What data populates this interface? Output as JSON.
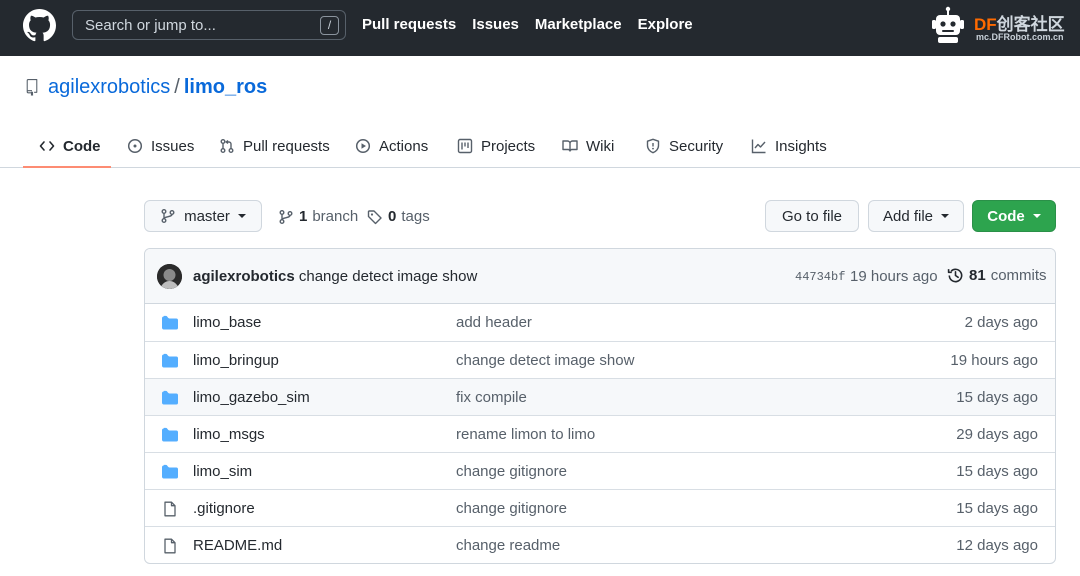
{
  "header": {
    "search_placeholder": "Search or jump to...",
    "search_shortcut": "/",
    "nav": [
      "Pull requests",
      "Issues",
      "Marketplace",
      "Explore"
    ]
  },
  "watermark": {
    "brand_df": "DF",
    "brand_cn": "创客社区",
    "url": "mc.DFRobot.com.cn"
  },
  "repo": {
    "owner": "agilexrobotics",
    "separator": "/",
    "name": "limo_ros"
  },
  "tabs": [
    {
      "label": "Code",
      "icon": "code-icon",
      "active": true
    },
    {
      "label": "Issues",
      "icon": "issue-opened-icon"
    },
    {
      "label": "Pull requests",
      "icon": "git-pull-request-icon"
    },
    {
      "label": "Actions",
      "icon": "play-icon"
    },
    {
      "label": "Projects",
      "icon": "project-icon"
    },
    {
      "label": "Wiki",
      "icon": "book-icon"
    },
    {
      "label": "Security",
      "icon": "shield-icon"
    },
    {
      "label": "Insights",
      "icon": "graph-icon"
    }
  ],
  "branch": {
    "current": "master",
    "branch_count": "1",
    "branch_label": "branch",
    "tag_count": "0",
    "tag_label": "tags"
  },
  "actions": {
    "go_to_file": "Go to file",
    "add_file": "Add file",
    "code": "Code"
  },
  "last_commit": {
    "author": "agilexrobotics",
    "message": "change detect image show",
    "sha": "44734bf",
    "time": "19 hours ago",
    "commit_count": "81",
    "commit_label": "commits"
  },
  "files": [
    {
      "name": "limo_base",
      "type": "dir",
      "message": "add header",
      "age": "2 days ago"
    },
    {
      "name": "limo_bringup",
      "type": "dir",
      "message": "change detect image show",
      "age": "19 hours ago"
    },
    {
      "name": "limo_gazebo_sim",
      "type": "dir",
      "message": "fix compile",
      "age": "15 days ago"
    },
    {
      "name": "limo_msgs",
      "type": "dir",
      "message": "rename limon to limo",
      "age": "29 days ago"
    },
    {
      "name": "limo_sim",
      "type": "dir",
      "message": "change gitignore",
      "age": "15 days ago"
    },
    {
      "name": ".gitignore",
      "type": "file",
      "message": "change gitignore",
      "age": "15 days ago"
    },
    {
      "name": "README.md",
      "type": "file",
      "message": "change readme",
      "age": "12 days ago"
    }
  ],
  "colors": {
    "header_bg": "#24292f",
    "link": "#0969da",
    "primary_button": "#2da44e",
    "folder_icon": "#54aeff",
    "tab_underline": "#fd8c73"
  }
}
